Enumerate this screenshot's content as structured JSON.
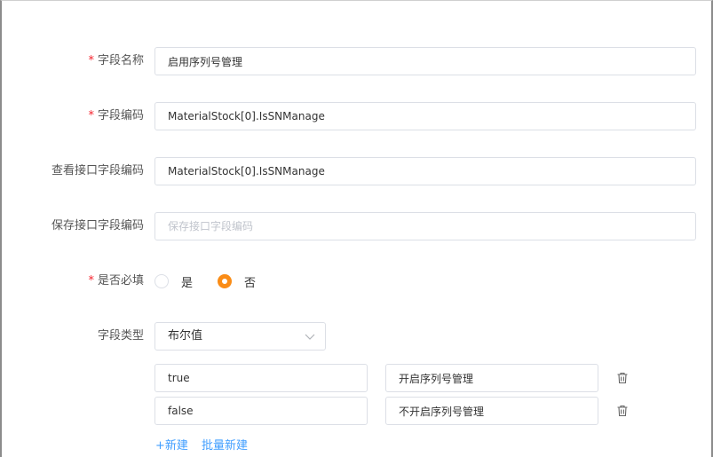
{
  "form": {
    "field_name": {
      "label": "字段名称",
      "required": "*",
      "value": "启用序列号管理"
    },
    "field_code": {
      "label": "字段编码",
      "required": "*",
      "value": "MaterialStock[0].IsSNManage"
    },
    "view_api_code": {
      "label": "查看接口字段编码",
      "value": "MaterialStock[0].IsSNManage"
    },
    "save_api_code": {
      "label": "保存接口字段编码",
      "value": "",
      "placeholder": "保存接口字段编码"
    },
    "is_required": {
      "label": "是否必填",
      "required": "*",
      "options": [
        "是",
        "否"
      ],
      "selected": "否"
    },
    "field_type": {
      "label": "字段类型",
      "value": "布尔值"
    },
    "options": [
      {
        "value": "true",
        "text": "开启序列号管理"
      },
      {
        "value": "false",
        "text": "不开启序列号管理"
      }
    ],
    "add_label": "+新建",
    "batch_add_label": "批量新建"
  },
  "icons": {
    "trash": "trash-icon",
    "chevron": "chevron-down-icon"
  },
  "colors": {
    "accent": "#fa8c16",
    "link": "#409eff",
    "required": "#f5222d",
    "border": "#dcdfe6"
  }
}
